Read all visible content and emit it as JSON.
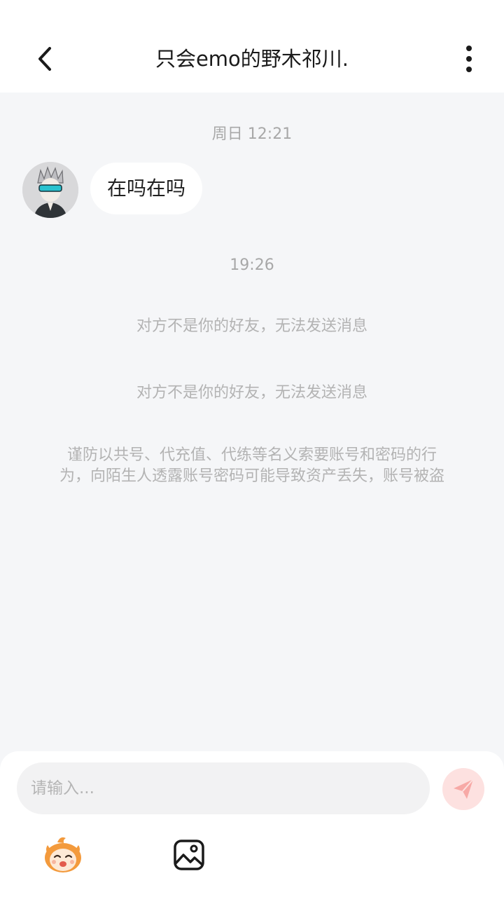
{
  "header": {
    "title": "只会emo的野木祁川.",
    "back_icon": "chevron-left-icon",
    "more_icon": "more-vertical-icon"
  },
  "chat": {
    "time_1": "周日 12:21",
    "message_1": "在吗在吗",
    "time_2": "19:26",
    "system_1": "对方不是你的好友，无法发送消息",
    "system_2": "对方不是你的好友，无法发送消息",
    "warning_line_1": "谨防以共号、代充值、代练等名义索要账号和密码的行",
    "warning_line_2": "为，向陌生人透露账号密码可能导致资产丢失，账号被盗"
  },
  "composer": {
    "placeholder": "请输入...",
    "send_icon": "paper-plane-icon",
    "emoji_icon": "mascot-emoji-icon",
    "image_icon": "image-icon"
  },
  "colors": {
    "background": "#f5f6f8",
    "send_button": "#fde1e0",
    "send_icon": "#f7a9a6",
    "mascot_orange": "#f39a3c"
  }
}
